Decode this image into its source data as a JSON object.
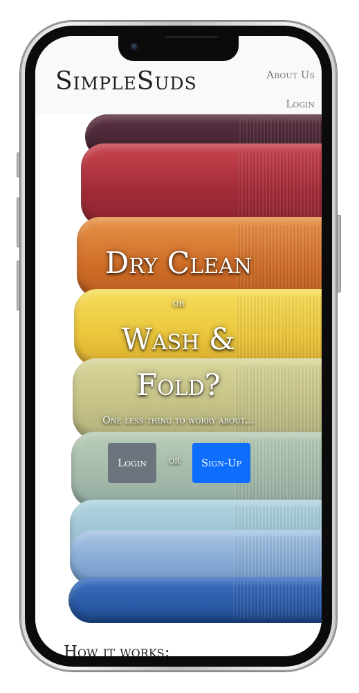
{
  "navbar": {
    "brand": "SimpleSuds",
    "links": [
      "About Us",
      "Login"
    ]
  },
  "hero": {
    "title_line1": "Dry Clean",
    "or_small": "or",
    "title_line2": "Wash &",
    "title_line3": "Fold?",
    "tagline": "One less thing to worry about...",
    "login_button": "Login",
    "or_between": "or",
    "signup_button": "Sign-Up"
  },
  "section": {
    "heading": "How it works:"
  },
  "colors": {
    "login_button": "#6c757d",
    "signup_button": "#0d6efd",
    "navbar_bg": "#f8f9fa",
    "towels": [
      "#4a2735",
      "#b63744",
      "#d57a33",
      "#eccd45",
      "#c6c48a",
      "#a8bca8",
      "#9fc3d2",
      "#88aed6",
      "#2e5fae"
    ]
  }
}
